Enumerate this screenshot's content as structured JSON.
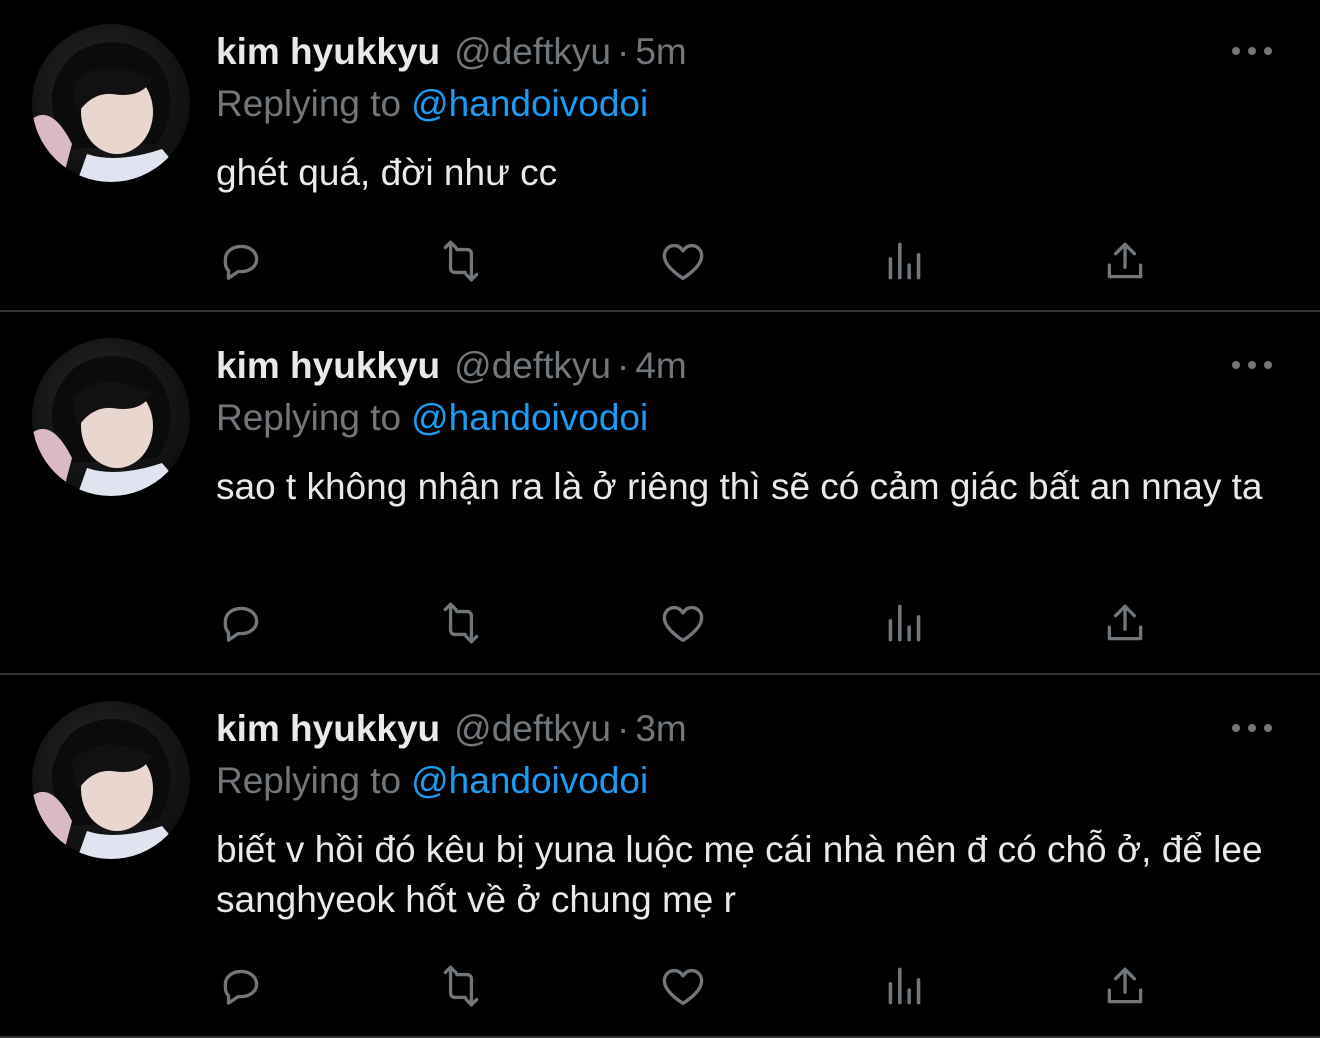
{
  "colors": {
    "background": "#000000",
    "text_primary": "#e7e9ea",
    "text_secondary": "#71767b",
    "accent": "#1d9bf0",
    "divider": "#2f3336"
  },
  "icons": {
    "more": "more-dots-icon",
    "reply": "reply-bubble-icon",
    "retweet": "retweet-arrows-icon",
    "like": "heart-icon",
    "views": "views-bar-chart-icon",
    "share": "share-upload-icon"
  },
  "tweets": [
    {
      "name": "kim hyukkyu",
      "handle": "@deftkyu",
      "separator": "·",
      "time": "5m",
      "replying_label": "Replying to",
      "replying_to": "@handoivodoi",
      "text": "ghét quá, đời như cc"
    },
    {
      "name": "kim hyukkyu",
      "handle": "@deftkyu",
      "separator": "·",
      "time": "4m",
      "replying_label": "Replying to",
      "replying_to": "@handoivodoi",
      "text": "sao t không nhận ra là ở riêng thì sẽ có cảm giác bất an nnay ta"
    },
    {
      "name": "kim hyukkyu",
      "handle": "@deftkyu",
      "separator": "·",
      "time": "3m",
      "replying_label": "Replying to",
      "replying_to": "@handoivodoi",
      "text": "biết v hồi đó kêu bị yuna luộc mẹ cái nhà nên đ có chỗ ở, để lee sanghyeok hốt về ở chung mẹ r"
    }
  ]
}
